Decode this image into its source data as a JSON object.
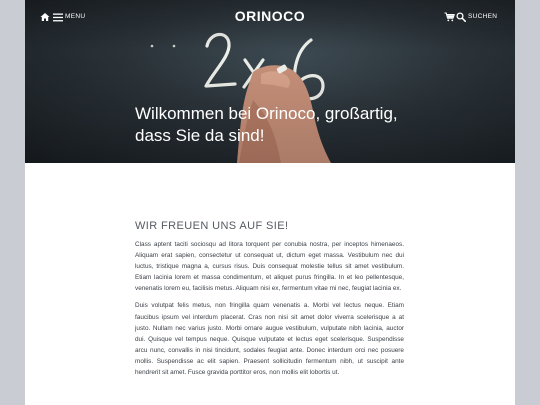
{
  "header": {
    "menu_label": "Menu",
    "brand": "ORINOCO",
    "search_label": "Suchen"
  },
  "hero": {
    "title": "Wilkommen bei Orinoco, großartig, dass Sie da sind!",
    "chalk_text": "2x6"
  },
  "content": {
    "heading": "Wir freuen uns auf Sie!",
    "paragraphs": [
      "Class aptent taciti sociosqu ad litora torquent per conubia nostra, per inceptos himenaeos. Aliquam erat sapien, consectetur ut consequat ut, dictum eget massa. Vestibulum nec dui luctus, tristique magna a, cursus risus. Duis consequat molestie tellus sit amet vestibulum. Etiam lacinia lorem et massa condimentum, et aliquet purus fringilla. In et leo pellentesque, venenatis lorem eu, facilisis metus. Aliquam nisi ex, fermentum vitae mi nec, feugiat lacinia ex.",
      "Duis volutpat felis metus, non fringilla quam venenatis a. Morbi vel lectus neque. Etiam faucibus ipsum vel interdum placerat. Cras non nisi sit amet dolor viverra scelerisque a at justo. Nullam nec varius justo. Morbi ornare augue vestibulum, vulputate nibh lacinia, auctor dui. Quisque vel tempus neque. Quisque vulputate et lectus eget scelerisque. Suspendisse arcu nunc, convallis in nisi tincidunt, sodales feugiat ante. Donec interdum orci nec posuere mollis. Suspendisse ac elit sapien. Praesent sollicitudin fermentum nibh, ut suscipit ante hendrerit sit amet. Fusce gravida porttitor eros, non mollis elit lobortis ut."
    ]
  },
  "colors": {
    "page_background": "#c9ccd2",
    "hero_chalkboard": "#2a3238",
    "heading_text": "#555a62",
    "body_text": "#3a3f46"
  },
  "icons": [
    "home-icon",
    "menu-icon",
    "cart-icon",
    "search-icon"
  ]
}
